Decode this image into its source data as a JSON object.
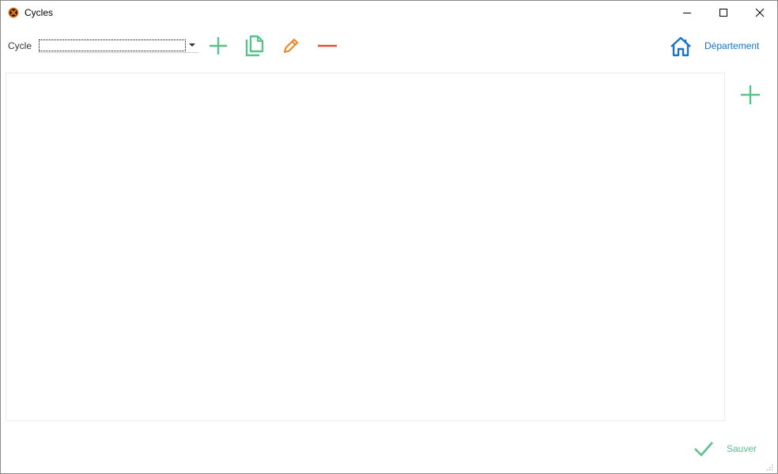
{
  "window": {
    "title": "Cycles"
  },
  "toolbar": {
    "cycle_label": "Cycle",
    "cycle_select": {
      "value": ""
    },
    "buttons": {
      "add_icon": "plus-icon",
      "copy_icon": "copy-icon",
      "edit_icon": "pencil-icon",
      "remove_icon": "minus-icon"
    },
    "home_icon": "home-icon",
    "department_link": "Département"
  },
  "side": {
    "add_icon": "plus-icon"
  },
  "footer": {
    "save_label": "Sauver",
    "save_icon": "check-icon"
  },
  "colors": {
    "green": "#59c28b",
    "orange": "#f0892b",
    "red": "#e54b3c",
    "blue": "#1a73c9"
  }
}
